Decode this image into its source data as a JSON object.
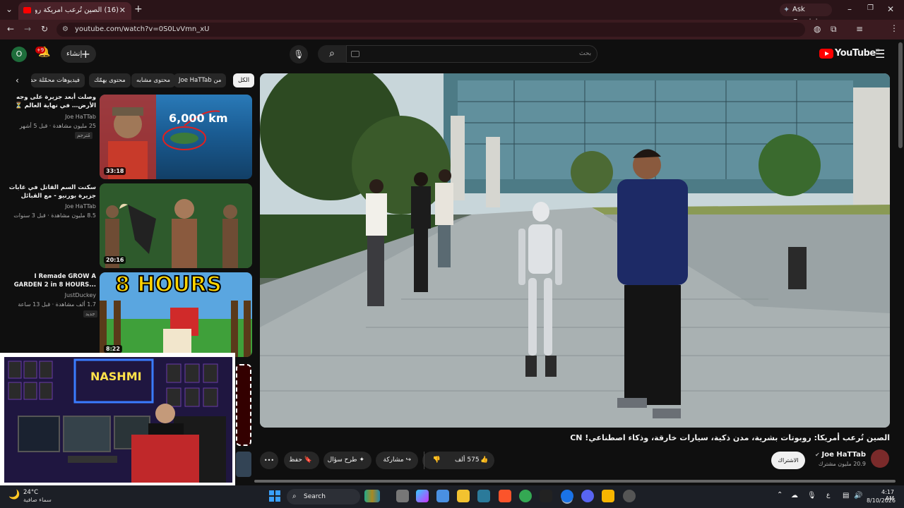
{
  "browser": {
    "tab_title": "(16) الصين تُرعب أمريكة روبو",
    "ask_gemini": "Ask Gemini",
    "url": "youtube.com/watch?v=0S0LvVmn_xU",
    "profile_letter": "O"
  },
  "youtube": {
    "logo_text": "YouTube",
    "logo_region": "JO",
    "search_placeholder": "بحث",
    "create_label": "إنشاء",
    "notifications_badge": "+9",
    "account_letter": "O"
  },
  "chips": [
    "الكل",
    "من Joe HaTTab",
    "محتوى مشابه",
    "محتوى يهمّك",
    "فيديوهات محمّلة حديثًا"
  ],
  "recommendations": [
    {
      "title": "وصلت أبعد جزيرة على وجه الأرض… في نهاية العالم ⏳",
      "channel": "Joe HaTTab",
      "meta": "25 مليون مشاهدة · قبل 5 أشهر",
      "badge": "مُترجم",
      "duration": "33:18",
      "thumb_text": "6,000 km"
    },
    {
      "title": "سكنت السم القاتل في غابات جزيرة بورنيو - مع القبائل",
      "channel": "Joe HaTTab",
      "meta": "8.5 مليون مشاهدة · قبل 3 سنوات",
      "duration": "20:16"
    },
    {
      "title": "I Remade GROW A GARDEN 2 in 8 HOURS...",
      "channel": "JustDuckey",
      "meta": "1.7 ألف مشاهدة · قبل 13 ساعة",
      "badge": "جديد",
      "duration": "8:22",
      "thumb_text": "8 HOURS"
    }
  ],
  "video": {
    "title": "الصين تُرعب أمريكا: روبوتات بشرية، مدن ذكية، سيارات خارقة، وذكاء اصطناعي! CN",
    "channel": "Joe HaTTab",
    "subscribers": "20.9 مليون مشترك",
    "subscribe_label": "الاشتراك",
    "likes": "575 ألف",
    "share_label": "مشاركة",
    "ask_label": "طرح سؤال",
    "save_label": "حفظ",
    "more_label": "•••"
  },
  "webcam": {
    "neon_sign": "NASHMI"
  },
  "taskbar": {
    "temperature": "24°C",
    "weather": "سماء صافية",
    "search_label": "Search",
    "time": "4:17 AM",
    "date": "8/10/2026",
    "lang": "ع"
  },
  "colors": {
    "background": "#0f0f0f",
    "browser_frame": "#3b1b20",
    "brand_red": "#ff0000",
    "chip_bg": "#272727"
  }
}
